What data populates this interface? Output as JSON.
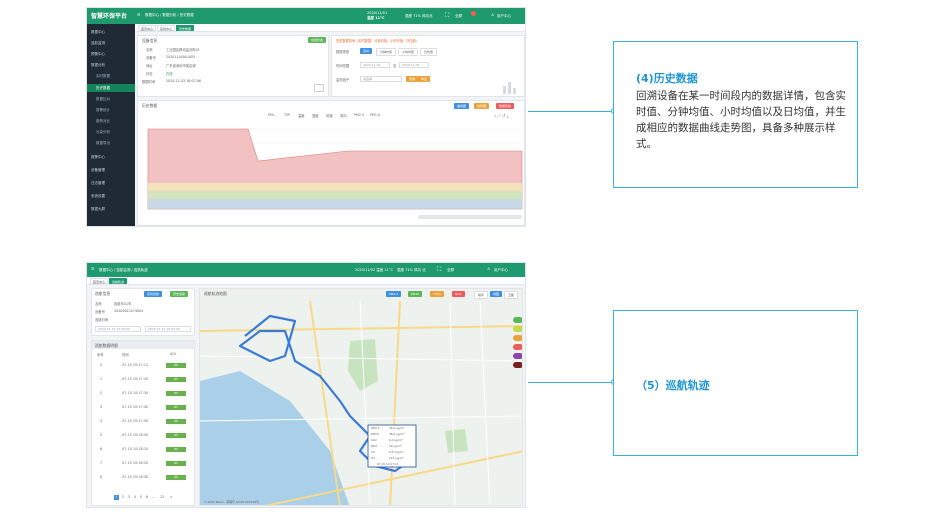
{
  "top_screenshot": {
    "app_title": "智慧环保平台",
    "breadcrumb": "数据中心 / 数据分析 / 历史数据",
    "header_stats": [
      "2020/11/01",
      "温度 11°C",
      "湿度 71% 风向北"
    ],
    "header_user": "用户中心",
    "header_fullscreen": "全屏",
    "sidebar": [
      "数据中心",
      "巡航监测",
      "预警中心",
      "数据分析",
      "实时数据",
      "历史数据",
      "数据比对",
      "报警统计",
      "趋势对比",
      "污染分析",
      "数据导出",
      "报警中心",
      "设备管理",
      "日志管理",
      "系统设置",
      "数据大屏"
    ],
    "tabs": [
      "首页中心",
      "实时中心",
      "历史数据"
    ],
    "device_panel": {
      "title": "设备信息",
      "badge": "在线状态",
      "labels": [
        "名称",
        "设备号",
        "地址",
        "状态",
        "数据时间"
      ],
      "values": [
        "工业园区移动监测车01",
        "20201104001005",
        "广东省深圳市某区域",
        "在线",
        "2020-11-03 16:07:06"
      ]
    },
    "query_panel": {
      "title": "历史数据查询（实时数据、分钟均值、小时均值、日均值）",
      "type_label": "数据类型",
      "types": [
        "实时",
        "分钟均值",
        "小时均值",
        "日均值"
      ],
      "time_label": "时间范围",
      "start": "2020-11-02",
      "end": "2020-11-03",
      "factor_label": "监测因子",
      "factor_placeholder": "请选择",
      "buttons": [
        "查询",
        "导出"
      ]
    },
    "chart_panel": {
      "title": "历史数据",
      "buttons": [
        "曲线图",
        "柱状图",
        "数据表格"
      ],
      "legend": [
        "PM₁₀",
        "TSP",
        "温度",
        "湿度",
        "风速",
        "风向",
        "PM2.5",
        "PM1.0"
      ]
    }
  },
  "bottom_screenshot": {
    "breadcrumb": "数据中心 / 巡航监测 / 巡航轨迹",
    "header_stats": [
      "2020/11/02 温度 11°C",
      "湿度 71% 风向 北"
    ],
    "header_user": "用户中心",
    "header_fullscreen": "全屏",
    "tabs": [
      "首页中心",
      "巡航轨迹"
    ],
    "device_panel": {
      "title": "巡航信息",
      "buttons": [
        "实时巡航",
        "历史巡航"
      ],
      "labels": [
        "名称",
        "设备号",
        "巡航时间"
      ],
      "values": [
        "巡航车01车",
        "20200612074004",
        ""
      ],
      "time_start": "2020-07-12 10:00:00",
      "time_end": "2020-07-12 18:00:00"
    },
    "list_panel": {
      "title": "巡航数据明细",
      "headers": [
        "序号",
        "时间",
        "AQI"
      ],
      "rows": [
        [
          "0",
          "07-15 10:17:11",
          "60"
        ],
        [
          "1",
          "07-15 10:17:20",
          "61"
        ],
        [
          "2",
          "07-15 10:17:30",
          "62"
        ],
        [
          "3",
          "07-15 10:17:40",
          "61"
        ],
        [
          "4",
          "07-15 10:17:50",
          "60"
        ],
        [
          "5",
          "07-15 10:18:00",
          "61"
        ],
        [
          "6",
          "07-15 10:18:10",
          "62"
        ],
        [
          "7",
          "07-15 10:18:20",
          "61"
        ],
        [
          "8",
          "07-15 10:18:30",
          "60"
        ]
      ],
      "pagination": [
        "1",
        "2",
        "3",
        "4",
        "5",
        "6",
        "...",
        "22",
        ">"
      ]
    },
    "map_panel": {
      "title": "巡航轨迹地图",
      "buttons": [
        "PM2.5",
        "PM10",
        "TVOC",
        "NO2",
        "噪声",
        "地图",
        "卫星",
        "路网"
      ],
      "popup": [
        [
          "PM2.5",
          "36.0 μg/m³"
        ],
        [
          "PM10",
          "48.0 μg/m³"
        ],
        [
          "SO2",
          "6.0 μg/m³"
        ],
        [
          "NO2",
          "16 μg/m³"
        ],
        [
          "CO",
          "0.5 mg/m³"
        ],
        [
          "O3",
          "112 μg/m³"
        ]
      ],
      "popup_time": "07-15 10:17:11",
      "copyright": "© 2020 Baidu - 审图号 GS(2019)5218号"
    }
  },
  "callout_history": {
    "title": "(4)历史数据",
    "body": "回溯设备在某一时间段内的数据详情，包含实时值、分钟均值、小时均值以及日均值，并生成相应的数据曲线走势图，具备多种展示样式。"
  },
  "callout_track": {
    "title": "（5）巡航轨迹"
  },
  "colors": {
    "brand": "#1f9a6e",
    "callout_border": "#3bb1e0",
    "callout_title": "#2196d3"
  }
}
